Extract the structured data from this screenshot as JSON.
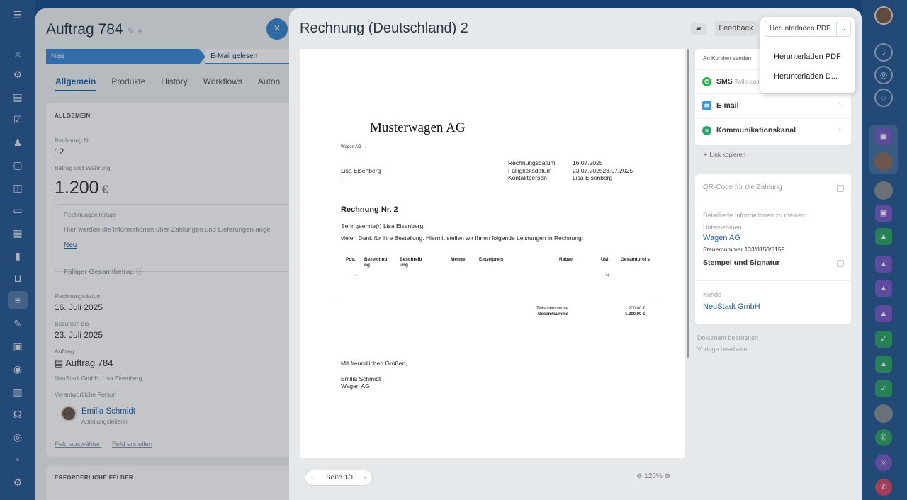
{
  "deal": {
    "title": "Auftrag 784",
    "close_label": "×",
    "stages": [
      "Neu",
      "E-Mail gelesen"
    ],
    "tabs": [
      "Allgemein",
      "Produkte",
      "History",
      "Workflows",
      "Auton"
    ],
    "section_general": "ALLGEMEIN",
    "invoice_no_label": "Rechnung Nr.",
    "invoice_no": "12",
    "amount_label": "Betrag und Währung",
    "amount": "1.200",
    "currency": "€",
    "entries_label": "Rechnungseinträge",
    "entries_hint": "Hier werden die Informationen über Zahlungen und Lieferungen ange",
    "new_link": "Neu",
    "due_total": "Fälliger Gesamtbetrag",
    "invoice_date_label": "Rechnungsdatum",
    "invoice_date": "16. Juli 2025",
    "pay_until_label": "Bezahlen bis",
    "pay_until": "23. Juli 2025",
    "order_label": "Auftrag",
    "order": "Auftrag 784",
    "order_sub": "NeuStadt GmbH, Lisa Eisenberg",
    "responsible_label": "Verantwortliche Person",
    "person_name": "Emilia Schmidt",
    "person_role": "Abteilungsleiterin",
    "field_select": "Feld auswählen",
    "field_create": "Feld erstellen",
    "required_section": "ERFORDERLICHE FELDER"
  },
  "slider": {
    "title": "Rechnung (Deutschland) 2",
    "feedback": "Feedback",
    "download_label": "Herunterladen PDF",
    "download_menu": [
      "Herunterladen PDF",
      "Herunterladen D..."
    ],
    "pager": "Seite 1/1",
    "zoom": "120%"
  },
  "document": {
    "company": "Musterwagen AG",
    "sender_line": "Wagen AG - ,  -",
    "recipient": "Lisa Eisenberg",
    "recipient_line2": ",",
    "meta_labels": [
      "Rechnungsdatum",
      "Fälligkeitsdatum",
      "Kontaktperson"
    ],
    "meta_values": [
      "16.07.2025",
      "23.07.202523.07.2025",
      "Lisa Eisenberg"
    ],
    "invoice_heading": "Rechnung Nr. 2",
    "greeting": "Sehr geehrte(r) Lisa Eisenberg,",
    "intro": "vielen Dank für ihre Bestellung. Hiermit stellen wir Ihnen folgende Leistungen in Rechnung:",
    "table_headers": [
      "Pos.",
      "Bezeichnu ng",
      "Beschreib ung",
      "Menge",
      "Einzelpreis",
      "Rabatt",
      "Ust.",
      "Gesamtprei s"
    ],
    "row_dash": "-",
    "row_percent": "%",
    "subtotal_label": "Zwischensumme",
    "subtotal_value": "1.200,00 €",
    "total_label": "Gesamtsumme",
    "total_value": "1.200,00 €",
    "closing": "Mit freundlichen Grüßen,",
    "signer": "Emilia Schmidt",
    "signer_company": "Wagen AG"
  },
  "side": {
    "send_label": "An Kunden senden",
    "sms": "SMS",
    "sms_provider": "Twilio.com",
    "email": "E-mail",
    "channel": "Kommunikationskanal",
    "copy_link": "Link kopieren",
    "qr_label": "QR-Code für die Zahlung",
    "company_info_label": "Detaillierte Informationen zu meinem Unternehmen",
    "company_name": "Wagen AG",
    "tax_number": "Steuernummer 133/8150/8159",
    "stamp_label": "Stempel und Signatur",
    "customer_label": "Kunde",
    "customer": "NeuStadt GmbH",
    "edit_document": "Dokument bearbeiten",
    "edit_template": "Vorlage bearbeiten"
  },
  "icons": {
    "menu": "menu-icon",
    "print": "printer-icon",
    "sms": "whatsapp-icon",
    "email": "mail-icon",
    "channel": "chat-icon",
    "link": "link-icon"
  },
  "colors": {
    "accent": "#2066b0",
    "stage_blue": "#3f8ad6",
    "background": "#1b4f8f"
  }
}
